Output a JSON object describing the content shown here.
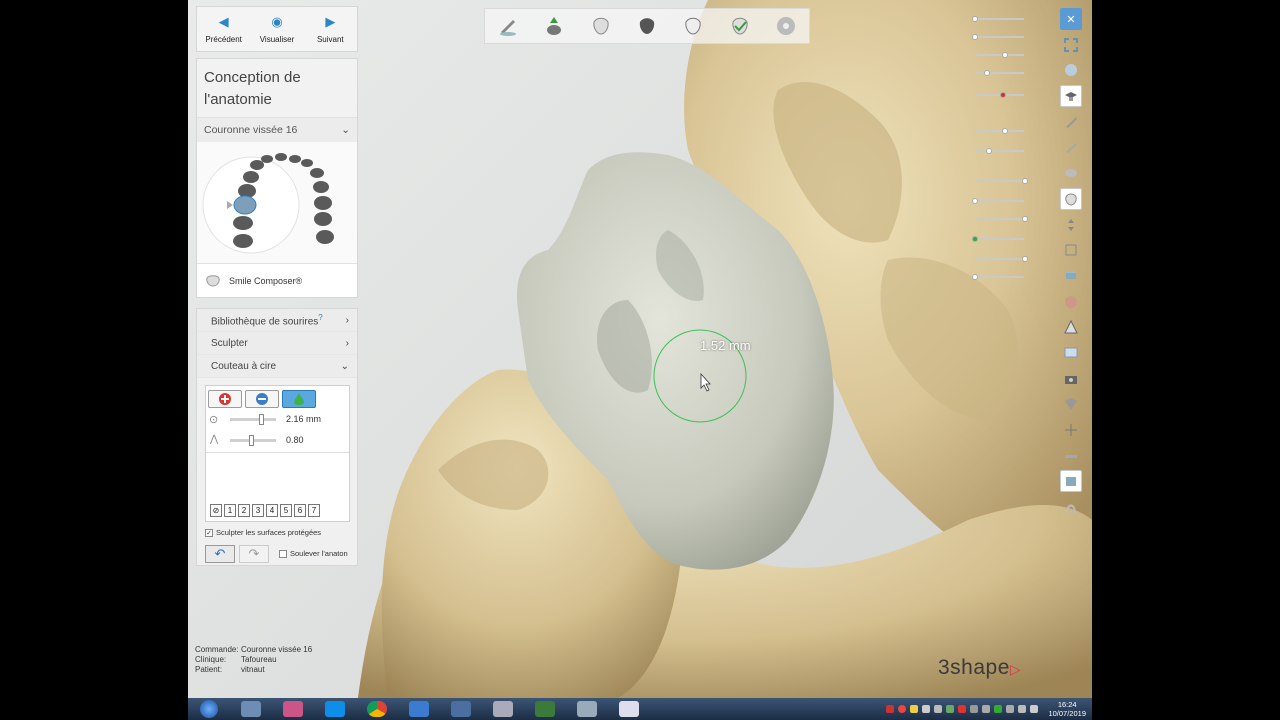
{
  "nav": {
    "prev": "Précédent",
    "view": "Visualiser",
    "next": "Suivant"
  },
  "design": {
    "title": "Conception de l'anatomie",
    "subtitle": "Couronne vissée 16",
    "smile_composer": "Smile Composer®"
  },
  "tools": {
    "library": "Bibliothèque de sourires",
    "library_help": "?",
    "sculpt": "Sculpter",
    "wax_knife": "Couteau à cire",
    "size_value": "2.16 mm",
    "strength_value": "0.80",
    "numbers": [
      "1",
      "2",
      "3",
      "4",
      "5",
      "6",
      "7"
    ],
    "protect_label": "Sculpter les surfaces protégées",
    "lift_label": "Soulever l'anaton"
  },
  "info": {
    "command_label": "Commande:",
    "command_value": "Couronne vissée 16",
    "clinic_label": "Clinique:",
    "clinic_value": "Tafoureau",
    "patient_label": "Patient:",
    "patient_value": "vitnaut"
  },
  "measure": "1.52 mm",
  "logo": "3shape",
  "clock": {
    "time": "16:24",
    "date": "10/07/2019"
  },
  "colors": {
    "accent": "#2a86c8",
    "gypsum": "#d8c49a",
    "crown": "#c9ccbf"
  }
}
